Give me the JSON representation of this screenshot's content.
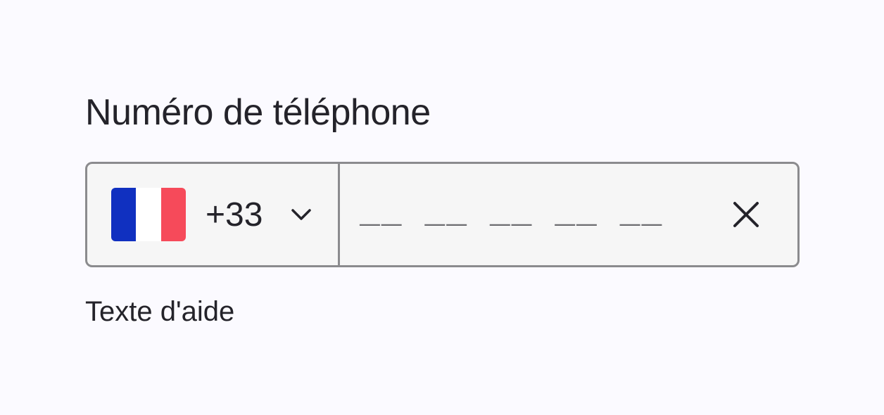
{
  "field": {
    "label": "Numéro de téléphone",
    "helper_text": "Texte d'aide"
  },
  "country": {
    "flag_icon": "flag-france-icon",
    "flag_colors": [
      "#1030c0",
      "#ffffff",
      "#f64a5a"
    ],
    "dial_code": "+33",
    "chevron_icon": "chevron-down-icon"
  },
  "phone": {
    "placeholder_mask": "__ __ __ __ __",
    "clear_icon": "close-icon"
  },
  "colors": {
    "background": "#fbfaff",
    "input_background": "#f6f6f6",
    "border": "#8b8b8e",
    "text": "#24232a"
  }
}
